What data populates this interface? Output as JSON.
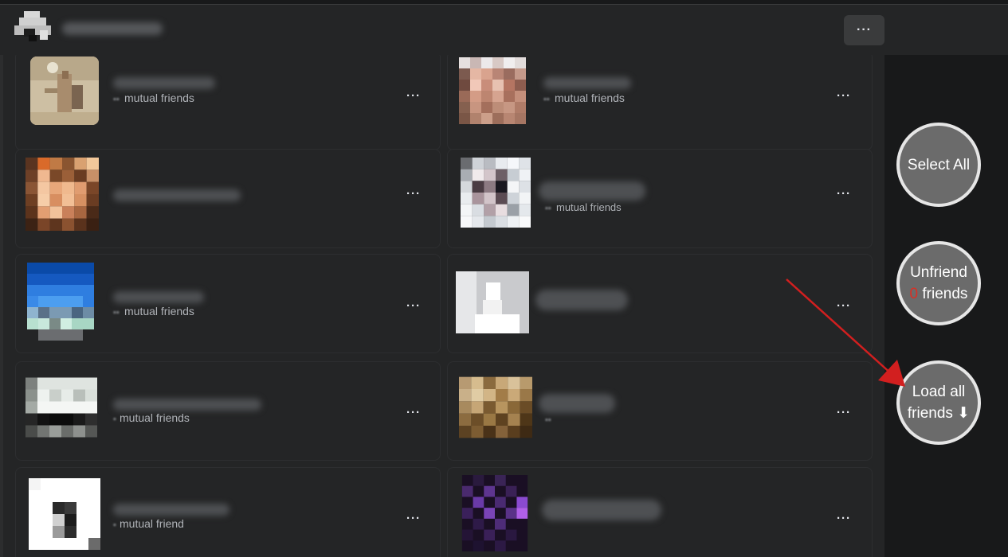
{
  "header": {
    "more_label": "···"
  },
  "friends": [
    {
      "mutual_text": "mutual friends",
      "more_label": "···"
    },
    {
      "mutual_text": "mutual friends",
      "more_label": "···"
    },
    {
      "mutual_text": "",
      "more_label": "···"
    },
    {
      "mutual_text": "mutual friends",
      "more_label": "···"
    },
    {
      "mutual_text": "mutual friends",
      "more_label": "···"
    },
    {
      "mutual_text": "",
      "more_label": "···"
    },
    {
      "mutual_text": "mutual friends",
      "more_label": "···"
    },
    {
      "mutual_text": "",
      "more_label": "···"
    },
    {
      "mutual_text": "mutual friend",
      "more_label": "···"
    },
    {
      "mutual_text": "",
      "more_label": "···"
    }
  ],
  "actions": {
    "select_all": "Select All",
    "unfriend_line1": "Unfriend",
    "unfriend_count": "0",
    "unfriend_line2": " friends",
    "load_line1": "Load all",
    "load_line2": "friends ⬇"
  },
  "colors": {
    "accent_red": "#d93025",
    "fab_bg": "#6b6b6b",
    "fab_border": "#e6e6e6"
  }
}
